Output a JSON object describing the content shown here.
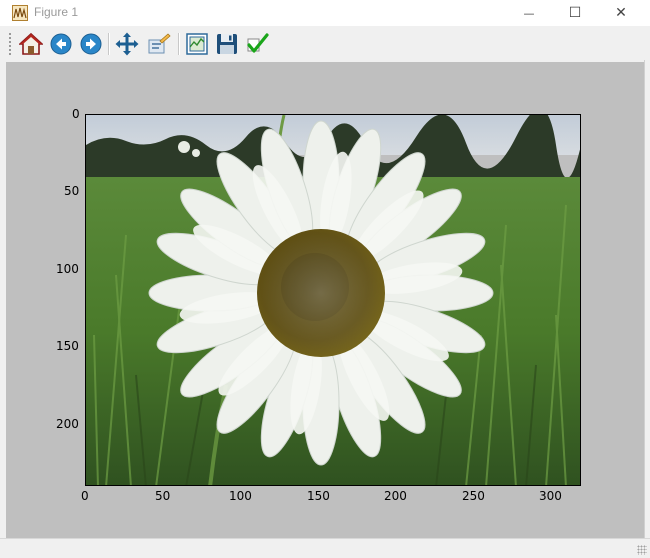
{
  "window": {
    "title": "Figure 1",
    "controls": {
      "minimize": "—",
      "maximize": "☐",
      "close": "✕"
    }
  },
  "toolbar": {
    "items": [
      {
        "name": "home-icon",
        "label": "Home"
      },
      {
        "name": "back-icon",
        "label": "Back"
      },
      {
        "name": "forward-icon",
        "label": "Forward"
      },
      {
        "name": "pan-icon",
        "label": "Pan"
      },
      {
        "name": "zoom-icon",
        "label": "Zoom"
      },
      {
        "name": "subplots-icon",
        "label": "Subplots"
      },
      {
        "name": "save-icon",
        "label": "Save"
      },
      {
        "name": "edit-check-icon",
        "label": "Edit"
      }
    ]
  },
  "chart_data": {
    "type": "image",
    "x_ticks": [
      "0",
      "50",
      "100",
      "150",
      "200",
      "250",
      "300"
    ],
    "y_ticks": [
      "0",
      "50",
      "100",
      "150",
      "200"
    ],
    "xlim": [
      0,
      320
    ],
    "ylim": [
      240,
      0
    ],
    "image": {
      "subject": "white daisy flower on grass field background",
      "colors": {
        "sky": "#c9d3dc",
        "treeline": "#2c3a28",
        "grass": "#4d7a2e",
        "grass_dark": "#2f4d1e",
        "petal": "#eef1ec",
        "petal_shadow": "#cfd6cf",
        "disk": "#5a4a0e",
        "disk_dark": "#3b3008"
      }
    }
  }
}
